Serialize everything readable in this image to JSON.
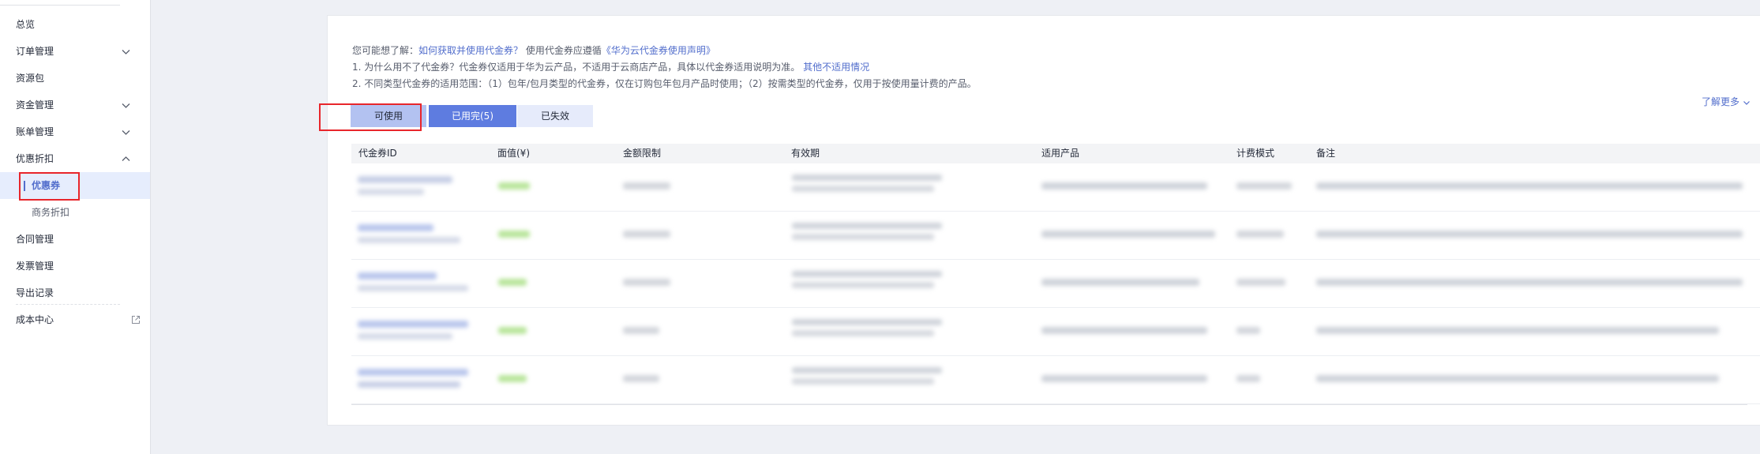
{
  "sidebar": {
    "items": [
      {
        "label": "总览"
      },
      {
        "label": "订单管理"
      },
      {
        "label": "资源包"
      },
      {
        "label": "资金管理"
      },
      {
        "label": "账单管理"
      },
      {
        "label": "优惠折扣"
      },
      {
        "label": "优惠券"
      },
      {
        "label": "商务折扣"
      },
      {
        "label": "合同管理"
      },
      {
        "label": "发票管理"
      },
      {
        "label": "导出记录"
      },
      {
        "label": "成本中心"
      }
    ]
  },
  "notice": {
    "line1_prefix": "您可能想了解：",
    "line1_link1": "如何获取并使用代金券？",
    "line1_mid": "使用代金券应遵循",
    "line1_link2": "《华为云代金券使用声明》",
    "line2_text": "1. 为什么用不了代金券？代金券仅适用于华为云产品，不适用于云商店产品，具体以代金券适用说明为准。",
    "line2_link": "其他不适用情况",
    "line3_text": "2. 不同类型代金券的适用范围：（1）包年/包月类型的代金券，仅在订购包年包月产品时使用；（2）按需类型的代金券，仅用于按使用量计费的产品。"
  },
  "tabs": [
    {
      "label": "可使用"
    },
    {
      "label": "已用完(5)"
    },
    {
      "label": "已失效"
    }
  ],
  "learn_more": "了解更多",
  "table": {
    "columns": [
      "代金券ID",
      "面值(¥)",
      "金额限制",
      "有效期",
      "适用产品",
      "计费模式",
      "备注"
    ]
  },
  "colors": {
    "accent": "#526ecc",
    "tab_selected_bg": "#5e7ce0",
    "tab_light_bg": "#b3c2f1",
    "highlight_box": "#e8262b",
    "value_green": "#7ed321"
  }
}
